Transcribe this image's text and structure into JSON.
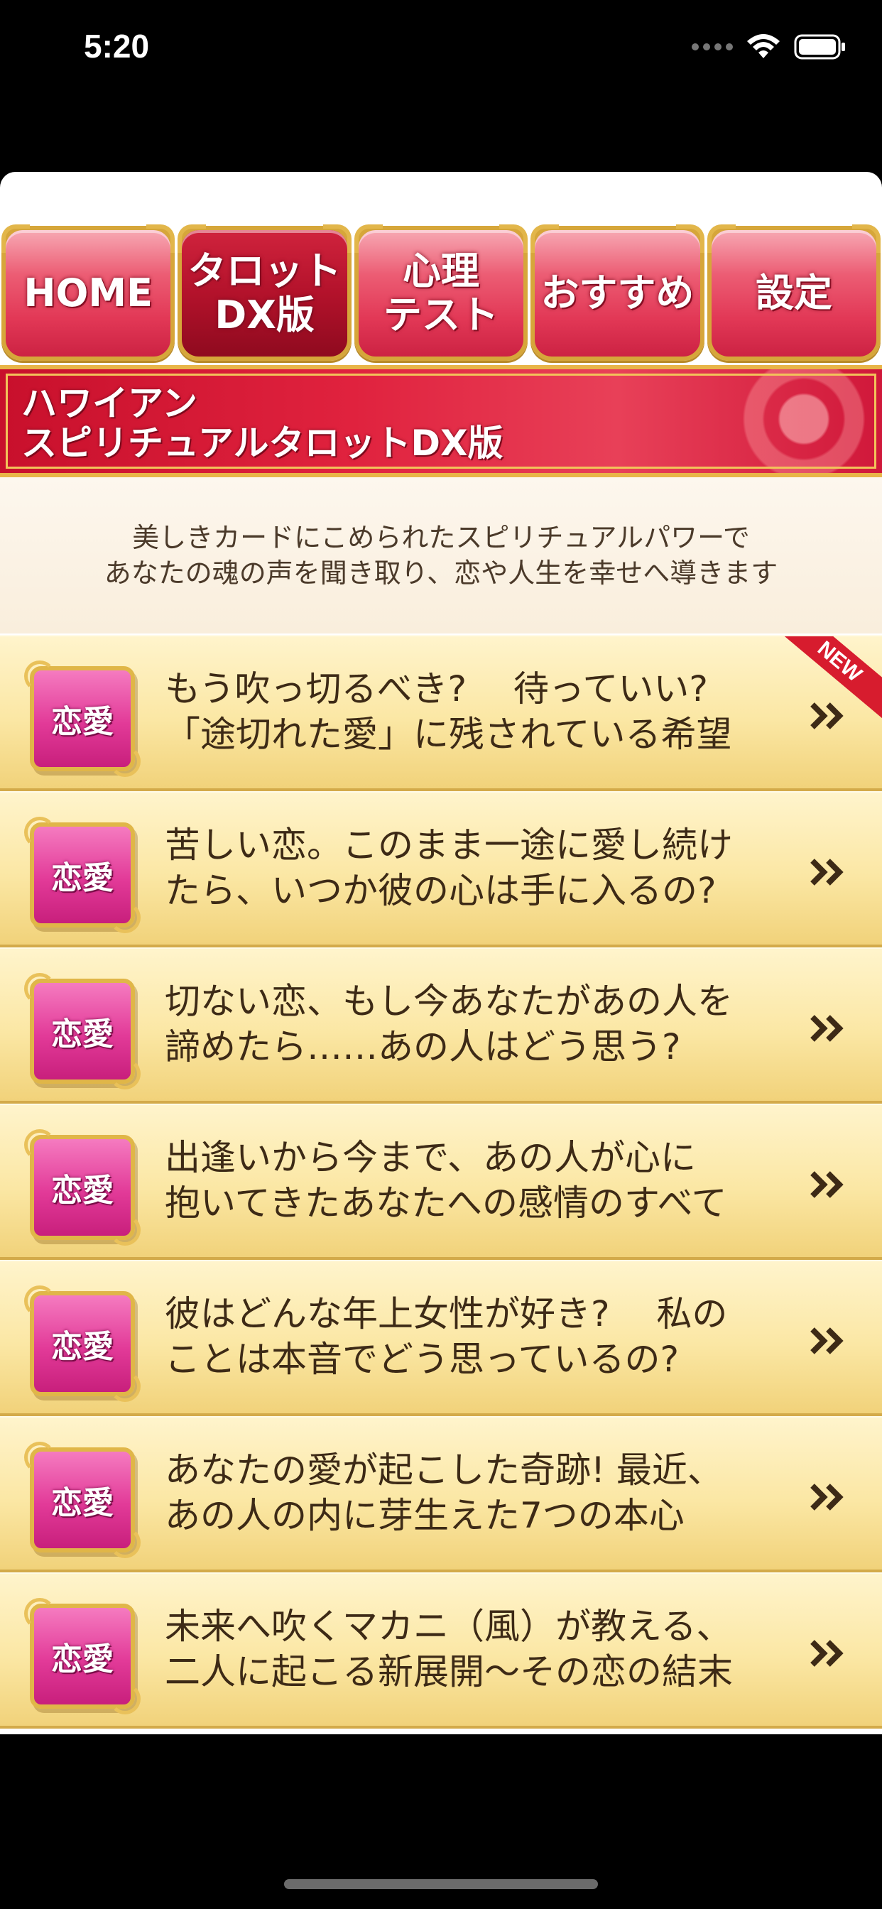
{
  "status_bar": {
    "time": "5:20"
  },
  "tabs": [
    {
      "label": "HOME",
      "active": false
    },
    {
      "label": "タロット\nDX版",
      "active": true
    },
    {
      "label": "心理\nテスト",
      "active": false
    },
    {
      "label": "おすすめ",
      "active": false
    },
    {
      "label": "設定",
      "active": false
    }
  ],
  "banner": {
    "title": "ハワイアン\nスピリチュアルタロットDX版"
  },
  "intro": {
    "line1": "美しきカードにこめられたスピリチュアルパワーで",
    "line2": "あなたの魂の声を聞き取り、恋や人生を幸せへ導きます"
  },
  "items": [
    {
      "badge": "恋愛",
      "text": "もう吹っ切るべき?　 待っていい?\n「途切れた愛」に残されている希望",
      "new_label": "NEW"
    },
    {
      "badge": "恋愛",
      "text": "苦しい恋。このまま一途に愛し続け\nたら、いつか彼の心は手に入るの?"
    },
    {
      "badge": "恋愛",
      "text": "切ない恋、もし今あなたがあの人を\n諦めたら……あの人はどう思う?"
    },
    {
      "badge": "恋愛",
      "text": "出逢いから今まで、あの人が心に\n抱いてきたあなたへの感情のすべて"
    },
    {
      "badge": "恋愛",
      "text": "彼はどんな年上女性が好き?　 私の\nことは本音でどう思っているの?"
    },
    {
      "badge": "恋愛",
      "text": "あなたの愛が起こした奇跡! 最近、\nあの人の内に芽生えた7つの本心"
    },
    {
      "badge": "恋愛",
      "text": "未来へ吹くマカニ（風）が教える、\n二人に起こる新展開～その恋の結末"
    }
  ],
  "colors": {
    "tab_pink": "#e23856",
    "tab_active": "#b3122b",
    "gold": "#d6a63a",
    "badge_pink": "#e23a98",
    "item_text": "#3d2a16"
  },
  "icons": {
    "chevron": "double-chevron-right-icon",
    "wifi": "wifi-icon",
    "battery": "battery-icon",
    "signal": "signal-icon"
  }
}
